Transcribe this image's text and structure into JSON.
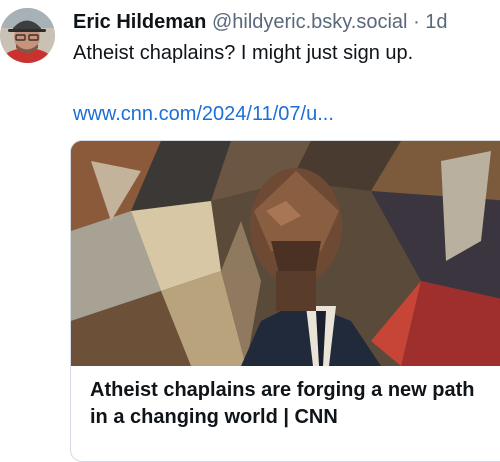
{
  "post": {
    "author_name": "Eric Hildeman",
    "handle": "@hildyeric.bsky.social",
    "separator": "·",
    "time_ago": "1d",
    "text": "Atheist chaplains? I might just sign up.",
    "link_text": "www.cnn.com/2024/11/07/u..."
  },
  "embed_card": {
    "title": "Atheist chaplains are forging a new path in a changing world | CNN"
  },
  "colors": {
    "name": "#0f1419",
    "muted": "#59687a",
    "link": "#1c6fd7",
    "card_border": "#d4dbe2"
  }
}
